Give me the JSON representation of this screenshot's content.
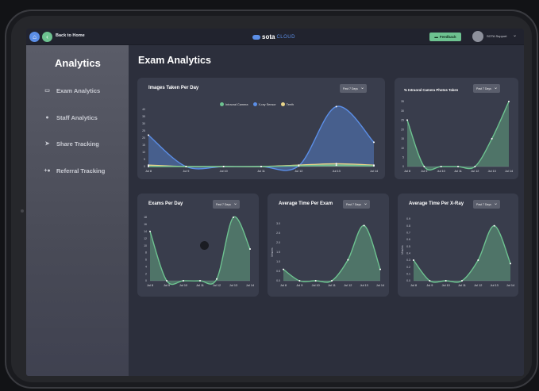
{
  "topbar": {
    "back_label": "Back to Home",
    "logo_sota": "sota",
    "logo_cloud": "CLOUD",
    "feedback_label": "Feedback",
    "user_name": "SOTA Support"
  },
  "sidebar": {
    "title": "Analytics",
    "items": [
      {
        "label": "Exam Analytics",
        "icon": "id-card-icon"
      },
      {
        "label": "Staff Analytics",
        "icon": "person-icon"
      },
      {
        "label": "Share Tracking",
        "icon": "send-icon"
      },
      {
        "label": "Referral Tracking",
        "icon": "user-plus-icon"
      }
    ]
  },
  "main": {
    "title": "Exam Analytics"
  },
  "colors": {
    "accent_green": "#6dc290",
    "accent_blue": "#5b8ee6",
    "teeth_yellow": "#e8d48a"
  },
  "cards": [
    {
      "title": "Images Taken Per Day",
      "dropdown": "Past 7 Days",
      "legend": [
        "Intraoral Camera",
        "X-ray Sensor",
        "Teeth"
      ]
    },
    {
      "title": "% Intraoral Camera Photos Taken",
      "dropdown": "Past 7 Days"
    },
    {
      "title": "Exams Per Day",
      "dropdown": "Past 7 Days"
    },
    {
      "title": "Average Time Per Exam",
      "dropdown": "Past 7 Days"
    },
    {
      "title": "Average Time Per X-Ray",
      "dropdown": "Past 7 Days"
    }
  ],
  "chart_data": [
    {
      "type": "area",
      "title": "Images Taken Per Day",
      "x": [
        "Jul 8",
        "Jul 9",
        "Jul 10",
        "Jul 11",
        "Jul 12",
        "Jul 13",
        "Jul 14"
      ],
      "yticks": [
        "0",
        "5",
        "10",
        "15",
        "20",
        "25",
        "30",
        "35",
        "40"
      ],
      "ylim": [
        0,
        40
      ],
      "series": [
        {
          "name": "Intraoral Camera",
          "color": "#6dc290",
          "values": [
            0,
            0,
            0,
            0,
            0.5,
            1,
            0.5
          ]
        },
        {
          "name": "X-ray Sensor",
          "color": "#5b8ee6",
          "values": [
            22,
            0,
            0,
            0,
            0.5,
            42,
            17
          ]
        },
        {
          "name": "Teeth",
          "color": "#e8d48a",
          "values": [
            1,
            0,
            0,
            0,
            1,
            2,
            1
          ]
        }
      ],
      "legend": "top-center"
    },
    {
      "type": "area",
      "title": "% Intraoral Camera Photos Taken",
      "x": [
        "Jul 8",
        "Jul 9",
        "Jul 10",
        "Jul 11",
        "Jul 12",
        "Jul 13",
        "Jul 14"
      ],
      "yticks": [
        "0",
        "5",
        "10",
        "15",
        "20",
        "25",
        "30",
        "35"
      ],
      "ylim": [
        0,
        35
      ],
      "series": [
        {
          "color": "#6dc290",
          "values": [
            25,
            0,
            0,
            0,
            0,
            15,
            35
          ]
        }
      ]
    },
    {
      "type": "area",
      "title": "Exams Per Day",
      "x": [
        "Jul 8",
        "Jul 9",
        "Jul 10",
        "Jul 11",
        "Jul 12",
        "Jul 13",
        "Jul 14"
      ],
      "yticks": [
        "0",
        "2",
        "4",
        "6",
        "8",
        "10",
        "12",
        "14",
        "16",
        "18"
      ],
      "ylim": [
        0,
        18
      ],
      "series": [
        {
          "color": "#6dc290",
          "values": [
            14,
            0,
            0,
            0,
            0.5,
            18,
            9
          ]
        }
      ]
    },
    {
      "type": "area",
      "title": "Average Time Per Exam",
      "ylabel": "Minutes",
      "x": [
        "Jul 8",
        "Jul 9",
        "Jul 10",
        "Jul 11",
        "Jul 12",
        "Jul 13",
        "Jul 14"
      ],
      "yticks": [
        "0.0",
        "0.5",
        "1.0",
        "1.5",
        "2.0",
        "2.5",
        "3.0"
      ],
      "ylim": [
        0,
        3
      ],
      "series": [
        {
          "color": "#6dc290",
          "values": [
            0.6,
            0,
            0,
            0,
            1.1,
            2.9,
            0.6
          ]
        }
      ]
    },
    {
      "type": "area",
      "title": "Average Time Per X-Ray",
      "ylabel": "Minutes",
      "x": [
        "Jul 8",
        "Jul 9",
        "Jul 10",
        "Jul 11",
        "Jul 12",
        "Jul 13",
        "Jul 14"
      ],
      "yticks": [
        "0.0",
        "0.1",
        "0.2",
        "0.3",
        "0.4",
        "0.5",
        "0.6",
        "0.7",
        "0.8",
        "0.9"
      ],
      "ylim": [
        0,
        0.9
      ],
      "series": [
        {
          "color": "#6dc290",
          "values": [
            0.3,
            0,
            0,
            0,
            0.3,
            0.8,
            0.25
          ]
        }
      ]
    }
  ]
}
